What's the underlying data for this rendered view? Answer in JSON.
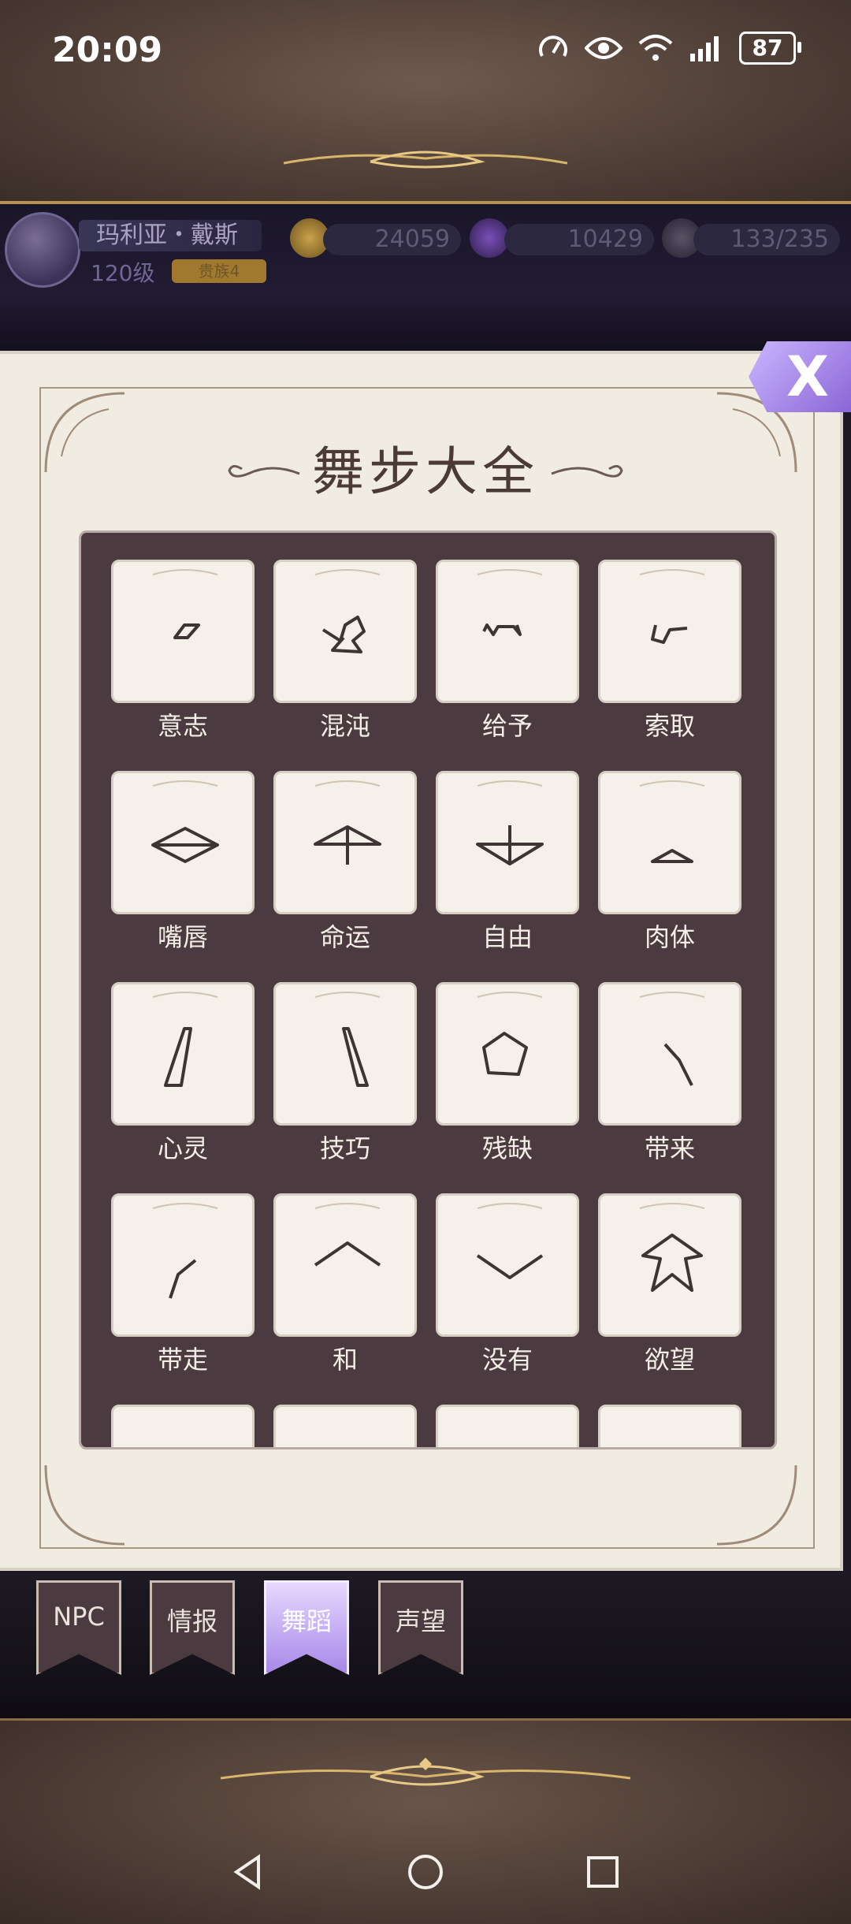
{
  "status_bar": {
    "time": "20:09",
    "battery": "87"
  },
  "player": {
    "name": "玛利亚・戴斯",
    "level": "120级",
    "title_badge": "贵族4"
  },
  "resources": {
    "gold": "24059",
    "gems": "10429",
    "stamina": "133/235"
  },
  "book": {
    "title": "舞步大全",
    "close_label": "X",
    "moves": [
      {
        "label": "意志",
        "icon": "will-glyph"
      },
      {
        "label": "混沌",
        "icon": "chaos-glyph"
      },
      {
        "label": "给予",
        "icon": "give-glyph"
      },
      {
        "label": "索取",
        "icon": "take-glyph"
      },
      {
        "label": "嘴唇",
        "icon": "lips-glyph"
      },
      {
        "label": "命运",
        "icon": "fate-glyph"
      },
      {
        "label": "自由",
        "icon": "freedom-glyph"
      },
      {
        "label": "肉体",
        "icon": "body-glyph"
      },
      {
        "label": "心灵",
        "icon": "soul-glyph"
      },
      {
        "label": "技巧",
        "icon": "skill-glyph"
      },
      {
        "label": "残缺",
        "icon": "broken-glyph"
      },
      {
        "label": "带来",
        "icon": "bring-glyph"
      },
      {
        "label": "带走",
        "icon": "take-away-glyph"
      },
      {
        "label": "和",
        "icon": "and-glyph"
      },
      {
        "label": "没有",
        "icon": "none-glyph"
      },
      {
        "label": "欲望",
        "icon": "desire-glyph"
      }
    ]
  },
  "tabs": [
    {
      "label": "NPC",
      "active": false
    },
    {
      "label": "情报",
      "active": false
    },
    {
      "label": "舞蹈",
      "active": true
    },
    {
      "label": "声望",
      "active": false
    }
  ],
  "colors": {
    "accent": "#a788e8",
    "panel": "#4b3b40",
    "page": "#f1ece2",
    "gold_trim": "#b7924f"
  }
}
